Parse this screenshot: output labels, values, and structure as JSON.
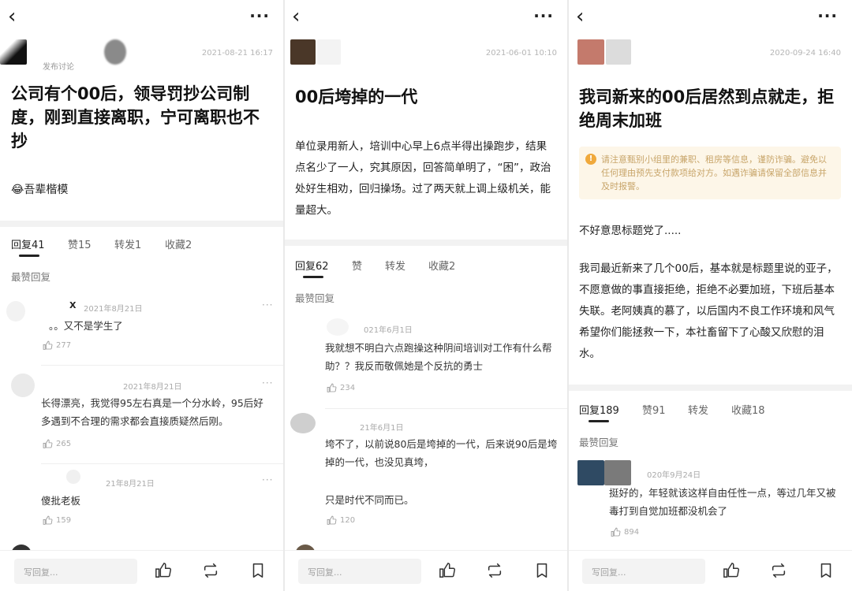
{
  "panels": [
    {
      "timestamp": "2021-08-21 16:17",
      "author_note": "发布讨论",
      "title": "公司有个00后，领导罚抄公司制度，刚到直接离职，宁可离职也不抄",
      "body": "😂吾辈楷模",
      "tabs": [
        "回复41",
        "赞15",
        "转发1",
        "收藏2"
      ],
      "section": "最赞回复",
      "comments": [
        {
          "time": "2021年8月21日",
          "text": "。。又不是学生了",
          "likes": "277"
        },
        {
          "time": "2021年8月21日",
          "text": "长得漂亮，我觉得95左右真是一个分水岭，95后好多遇到不合理的需求都会直接质疑然后刚。",
          "likes": "265"
        },
        {
          "time": "21年8月21日",
          "text": "傻批老板",
          "likes": "159"
        }
      ],
      "reply_placeholder": "写回复..."
    },
    {
      "timestamp": "2021-06-01 10:10",
      "title": "00后垮掉的一代",
      "body": "单位录用新人，培训中心早上6点半得出操跑步，结果点名少了一人，究其原因，回答简单明了，“困”，政治处好生相劝，回归操场。过了两天就上调上级机关，能量超大。",
      "tabs": [
        "回复62",
        "赞",
        "转发",
        "收藏2"
      ],
      "section": "最赞回复",
      "comments": [
        {
          "time": "021年6月1日",
          "text": "我就想不明白六点跑操这种阴间培训对工作有什么帮助？？我反而敬佩她是个反抗的勇士",
          "likes": "234"
        },
        {
          "time": "21年6月1日",
          "text": "垮不了，以前说80后是垮掉的一代，后来说90后是垮掉的一代，也没见真垮，",
          "text2": "只是时代不同而已。",
          "likes": "120"
        }
      ],
      "reply_placeholder": "写回复..."
    },
    {
      "timestamp": "2020-09-24 16:40",
      "title": "我司新来的00后居然到点就走，拒绝周末加班",
      "notice": "请注意甄别小组里的兼职、租房等信息，谨防诈骗。避免以任何理由预先支付款项给对方。如遇诈骗请保留全部信息并及时报警。",
      "body_intro": "不好意思标题党了.....",
      "body": "我司最近新来了几个00后，基本就是标题里说的亚子，不愿意做的事直接拒绝，拒绝不必要加班，下班后基本失联。老阿姨真的慕了，以后国内不良工作环境和风气希望你们能拯救一下，本社畜留下了心酸又欣慰的泪水。",
      "tabs": [
        "回复189",
        "赞91",
        "转发",
        "收藏18"
      ],
      "section": "最赞回复",
      "comments": [
        {
          "time": "020年9月24日",
          "text": "挺好的，年轻就该这样自由任性一点，等过几年又被毒打到自觉加班都没机会了",
          "likes": "894"
        }
      ],
      "reply_placeholder": "写回复..."
    }
  ],
  "colors": {
    "accent": "#222222",
    "muted": "#777777",
    "notice_bg": "#fdf6e8",
    "notice_text": "#c8a56a",
    "warn": "#f0a93c"
  },
  "icons": [
    "back-arrow-icon",
    "more-dots-icon",
    "thumb-up-icon",
    "repost-icon",
    "bookmark-icon",
    "warning-icon"
  ]
}
